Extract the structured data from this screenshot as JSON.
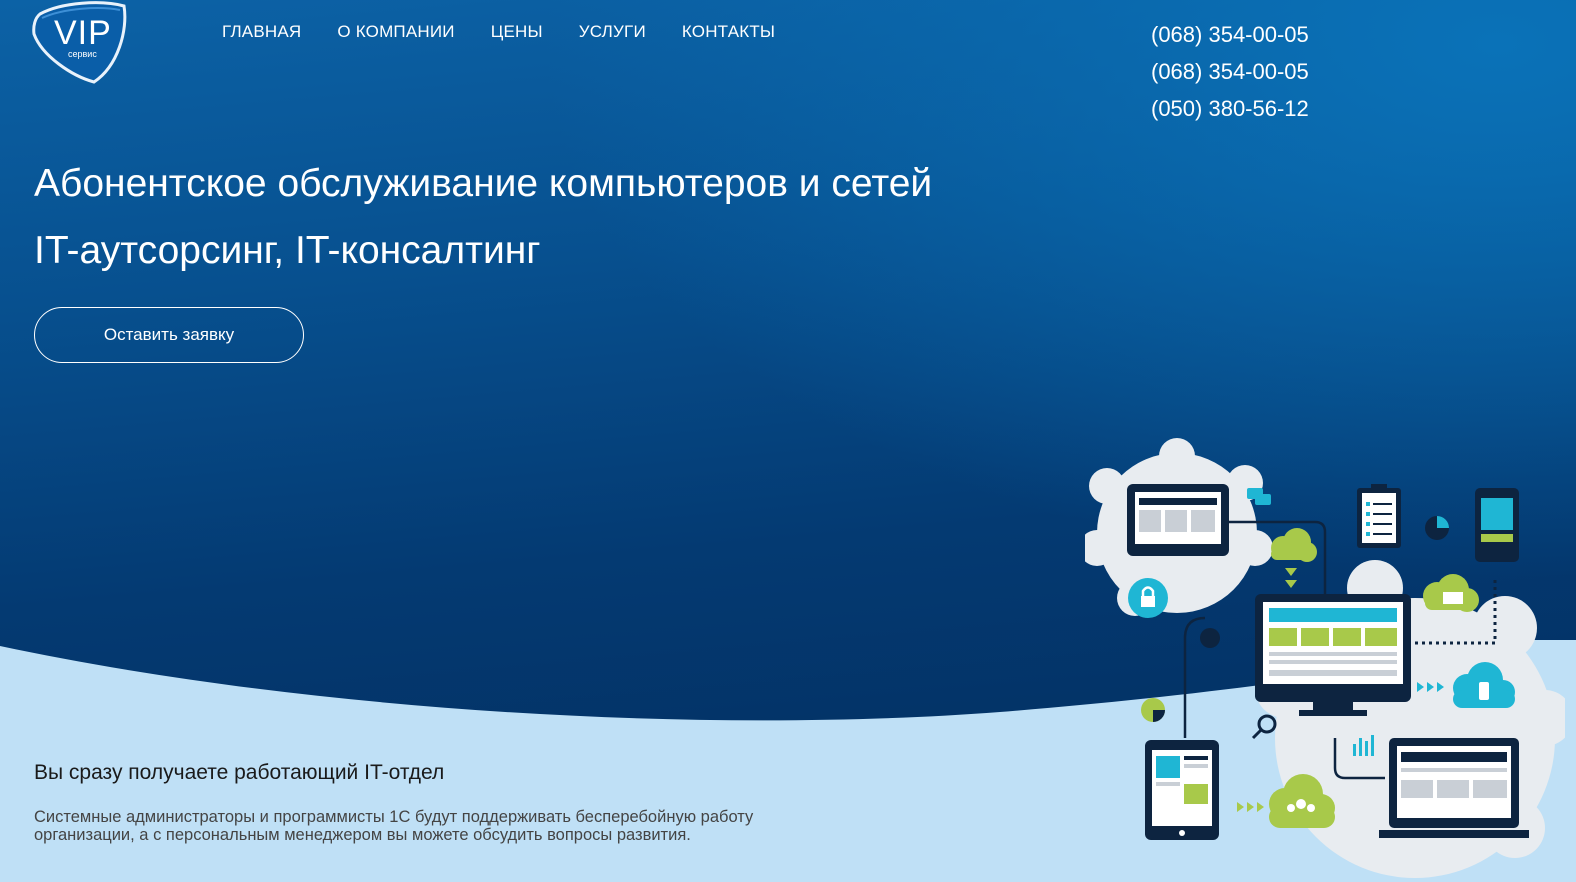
{
  "logo": {
    "text": "VIP",
    "subtext": "сервис"
  },
  "nav": {
    "items": [
      "ГЛАВНАЯ",
      "О КОМПАНИИ",
      "ЦЕНЫ",
      "УСЛУГИ",
      "КОНТАКТЫ"
    ]
  },
  "phones": [
    "(068) 354-00-05",
    "(068) 354-00-05",
    "(050) 380-56-12"
  ],
  "hero": {
    "title": "Абонентское обслуживание компьютеров и сетей",
    "subtitle": "IT-аутсорсинг, IT-консалтинг",
    "cta_label": "Оставить заявку"
  },
  "benefit": {
    "title": "Вы сразу получаете работающий IT-отдел",
    "text": "Системные администраторы и программисты 1С будут поддерживать бесперебойную работу организации, а с персональным менеджером вы можете обсудить вопросы развития."
  },
  "colors": {
    "hero_top": "#0c62a6",
    "hero_bottom": "#022c5c",
    "wave": "#bfe0f6",
    "accent_teal": "#1fb6d4",
    "accent_green": "#a8c94a"
  },
  "illustration": {
    "icons": [
      "gear-icon",
      "monitor-icon",
      "tablet-icon",
      "laptop-icon",
      "smartphone-icon",
      "cloud-icon",
      "lock-icon",
      "clipboard-icon",
      "chat-icon",
      "mail-icon",
      "magnifier-icon",
      "users-icon",
      "chart-icon"
    ]
  }
}
